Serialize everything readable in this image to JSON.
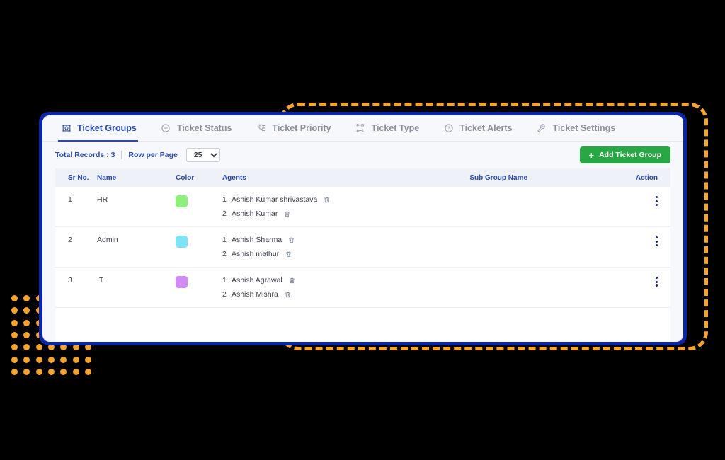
{
  "window": {
    "border_color": "#0A26A8",
    "accent_dashed_color": "#F8A32B"
  },
  "tabs": [
    {
      "label": "Ticket Groups",
      "icon": "ticket-groups-icon",
      "active": true
    },
    {
      "label": "Ticket Status",
      "icon": "ticket-status-icon",
      "active": false
    },
    {
      "label": "Ticket Priority",
      "icon": "ticket-priority-icon",
      "active": false
    },
    {
      "label": "Ticket Type",
      "icon": "ticket-type-icon",
      "active": false
    },
    {
      "label": "Ticket Alerts",
      "icon": "ticket-alerts-icon",
      "active": false
    },
    {
      "label": "Ticket Settings",
      "icon": "ticket-settings-icon",
      "active": false
    }
  ],
  "toolbar": {
    "total_records_label": "Total Records : 3",
    "row_per_page_label": "Row per Page",
    "rows_per_page_value": "25",
    "rows_per_page_options": [
      "25"
    ],
    "add_button_label": "Add Ticket Group",
    "add_button_color": "#27A844"
  },
  "table": {
    "columns": [
      "Sr No.",
      "Name",
      "Color",
      "Agents",
      "Sub Group Name",
      "Action"
    ],
    "rows": [
      {
        "sr_no": "1",
        "name": "HR",
        "color": "#8CF07A",
        "sub_group_name": "",
        "agents": [
          {
            "index": "1",
            "name": "Ashish Kumar shrivastava"
          },
          {
            "index": "2",
            "name": "Ashish Kumar"
          }
        ]
      },
      {
        "sr_no": "2",
        "name": "Admin",
        "color": "#7FE3F7",
        "sub_group_name": "",
        "agents": [
          {
            "index": "1",
            "name": "Ashish Sharma"
          },
          {
            "index": "2",
            "name": "Ashish mathur"
          }
        ]
      },
      {
        "sr_no": "3",
        "name": "IT",
        "color": "#D18BF5",
        "sub_group_name": "",
        "agents": [
          {
            "index": "1",
            "name": "Ashish Agrawal"
          },
          {
            "index": "2",
            "name": "Ashish Mishra"
          }
        ]
      }
    ]
  }
}
